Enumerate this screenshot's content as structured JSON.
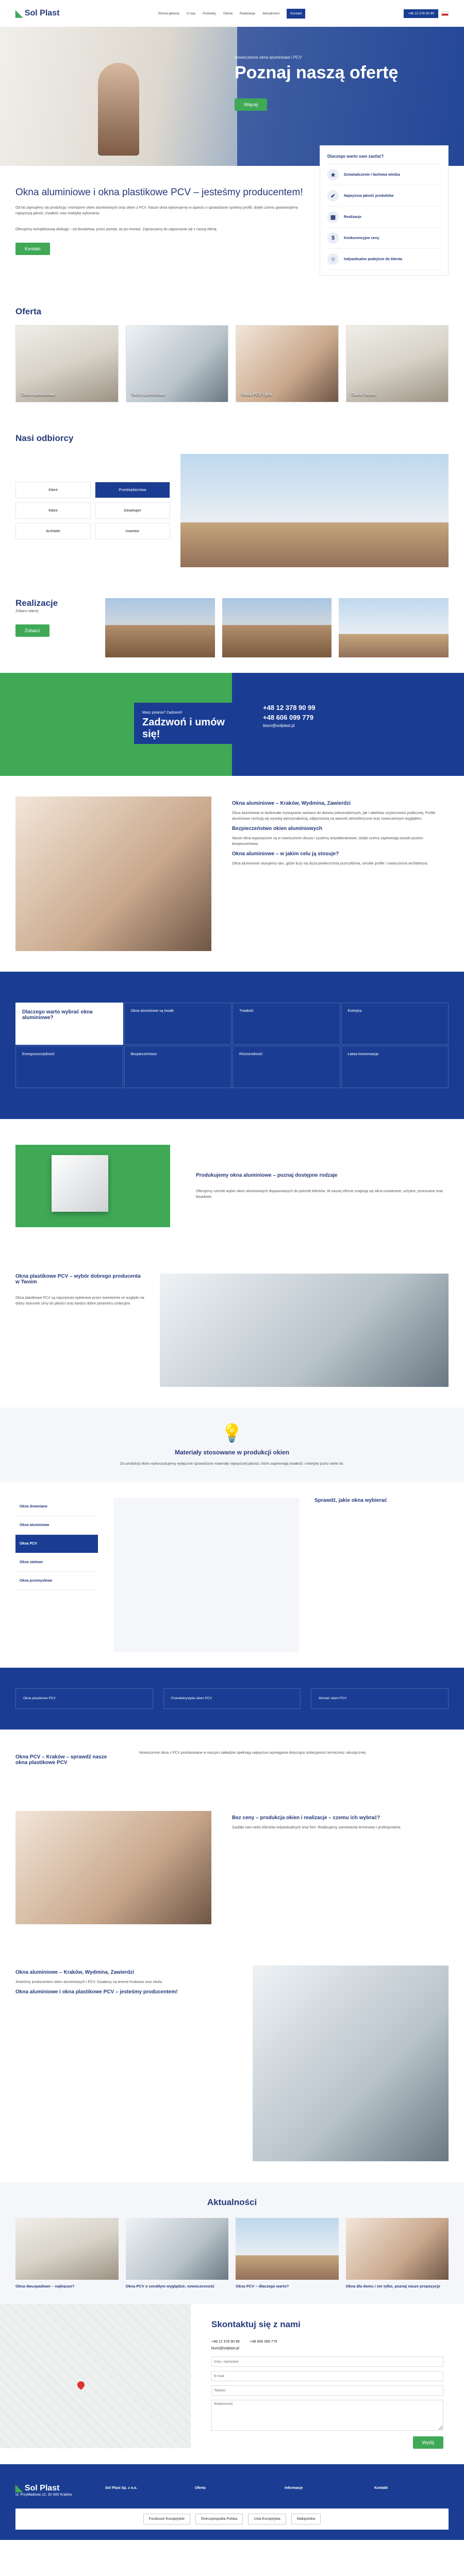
{
  "header": {
    "logo": "Sol Plast",
    "logo_mark": "◣",
    "menu": [
      "Strona główna",
      "O nas",
      "Produkty",
      "Oferta",
      "Realizacje",
      "Aktualności",
      "Kontakt"
    ],
    "active": "Kontakt",
    "phone": "+48 12 378 90 99"
  },
  "hero": {
    "small": "Nowoczesne okna aluminiowe i PCV",
    "big": "Poznaj naszą ofertę",
    "cta": "Więcej"
  },
  "intro": {
    "title": "Okna aluminiowe i okna plastikowe PCV – jesteśmy producentem!",
    "para1": "Od lat zajmujemy się produkcją i montażem okien aluminiowych oraz okien z PCV. Nasze okna wykonujemy w oparciu o sprawdzone systemy profili, dzięki czemu gwarantujemy najwyższą jakość, trwałość oraz estetykę wykonania.",
    "para2": "Oferujemy kompleksową obsługę – od doradztwa, przez pomiar, aż po montaż. Zapraszamy do zapoznania się z naszą ofertą.",
    "cta": "Kontakt"
  },
  "features": {
    "head": "Dlaczego warto nam zaufać?",
    "items": [
      "Doświadczenie i fachowa wiedza",
      "Najwyższa jakość produktów",
      "Realizacje",
      "Konkurencyjne ceny",
      "Indywidualne podejście do klienta"
    ]
  },
  "offer": {
    "title": "Oferta",
    "cards": [
      "Okna aluminiowe",
      "Okna aluminiowe",
      "Okna PCV i pcv",
      "Okna i drzwi"
    ]
  },
  "clients": {
    "title": "Nasi odbiorcy",
    "tiles": [
      "Klient",
      "Przedsiębiorstwa",
      "Klient",
      "Deweloper",
      "Architekt",
      "Inwestor"
    ],
    "active": "Przedsiębiorstwa"
  },
  "realizations": {
    "title": "Realizacje",
    "sub": "Zobacz więcej",
    "cta": "Zobacz"
  },
  "cta": {
    "small": "Masz pytania? Zadzwoń!",
    "big": "Zadzwoń i umów się!",
    "phone1": "+48 12 378 90 99",
    "phone2": "+48 606 099 779",
    "email": "biuro@solplast.pl"
  },
  "about": {
    "h1": "Okna aluminiowe – Kraków, Wydmina, Zawierdzi",
    "p1": "Okna aluminiowe to doskonałe rozwiązanie zarówno do domów jednorodzinnych, jak i obiektów użyteczności publicznej. Profile aluminiowe cechują się wysoką wytrzymałością, odpornością na warunki atmosferyczne oraz nowoczesnym wyglądem.",
    "h2": "Bezpieczeństwo okien aluminiowych",
    "p2": "Nasze okna wyposażone są w nowoczesne okucia i systemy antywłamaniowe, dzięki czemu zapewniają wysoki poziom bezpieczeństwa.",
    "h3": "Okna aluminiowe – w jakim celu ją stosuje?",
    "p3": "Okna aluminiowe stosujemy tam, gdzie liczy się duża powierzchnia przeszklenia, smukłe profile i nowoczesna architektura."
  },
  "band": {
    "first": "Dlaczego warto wybrać okna aluminiowe?",
    "cells": [
      "Okna aluminiowe są trwałe",
      "Trwałość",
      "Estetyka",
      "Energooszczędność",
      "Bezpieczeństwo",
      "Różnorodność",
      "Łatwa konserwacja"
    ]
  },
  "window": {
    "title": "Produkujemy okna aluminiowe – poznaj dostępne rodzaje",
    "p": "Oferujemy szeroki wybór okien aluminiowych dopasowanych do potrzeb klientów. W naszej ofercie znajdują się okna rozwierane, uchylne, przesuwne oraz fasadowe."
  },
  "pvc": {
    "title": "Okna plastikowe PCV – wybór dobrego producenta w Twoim",
    "p": "Okna plastikowe PCV są najczęściej wybierane przez inwestorów ze względu na dobry stosunek ceny do jakości oraz bardzo dobre parametry izolacyjne."
  },
  "bulb": {
    "title": "Materiały stosowane w produkcji okien",
    "p": "Do produkcji okien wykorzystujemy wyłącznie sprawdzone materiały najwyższej jakości, które zapewniają trwałość i estetykę przez wiele lat."
  },
  "types": {
    "items": [
      "Okna drewniane",
      "Okna aluminiowe",
      "Okna PCV",
      "Okna stalowe",
      "Okna przemysłowe"
    ],
    "active": "Okna PCV",
    "title": "Sprawdź, jakie okna wybierać"
  },
  "blue3": {
    "c1": "Okna plastikowe PCV",
    "c2": "Charakterystyka okien PCV",
    "c3": "Montaż okien PCV"
  },
  "wood": {
    "title": "Okna PCV – Kraków – sprawdź nasze okna plastikowe PCV",
    "p": "Nowoczesne okna z PCV produkowane w naszym zakładzie spełniają najwyższe wymagania dotyczące izolacyjności termicznej i akustycznej."
  },
  "choice": {
    "title": "Bez ceny – produkcja okien i realizacje – czemu ich wybrać?",
    "p": "Zaufało nam wielu klientów indywidualnych oraz firm. Realizujemy zamówienia terminowo i profesjonalnie."
  },
  "krakow": {
    "h": "Okna aluminiowe – Kraków, Wydmina, Zawierdzi",
    "p": "Jesteśmy producentem okien aluminiowych i PCV. Działamy na terenie Krakowa oraz okolic.",
    "h2": "Okna aluminiowe i okna plastikowe PCV – jesteśmy producentem!"
  },
  "news": {
    "title": "Aktualności",
    "items": [
      "Okna dwuspadowe – najlepsze?",
      "Okna PCV o smukłym wyglądzie, nowoczesność",
      "Okna PCV – dlaczego warto?",
      "Okna dla domu i nie tylko, poznaj nasze propozycje"
    ]
  },
  "contact": {
    "title": "Skontaktuj się z nami",
    "phone1": "+48 12 378 90 99",
    "phone2": "+48 606 099 779",
    "email": "biuro@solplast.pl",
    "name": "Imię i nazwisko",
    "mail": "E-mail",
    "phone": "Telefon",
    "msg": "Wiadomość",
    "send": "Wyślij"
  },
  "footer": {
    "logo": "Sol Plast",
    "c1": "Sol Plast Sp. z o.o.",
    "c2": "Oferta",
    "c3": "Informacje",
    "c4": "Kontakt",
    "address": "ul. Przykładowa 12, 32-000 Kraków",
    "ue": [
      "Fundusze Europejskie",
      "Rzeczpospolita Polska",
      "Unia Europejska",
      "Małopolska"
    ]
  }
}
